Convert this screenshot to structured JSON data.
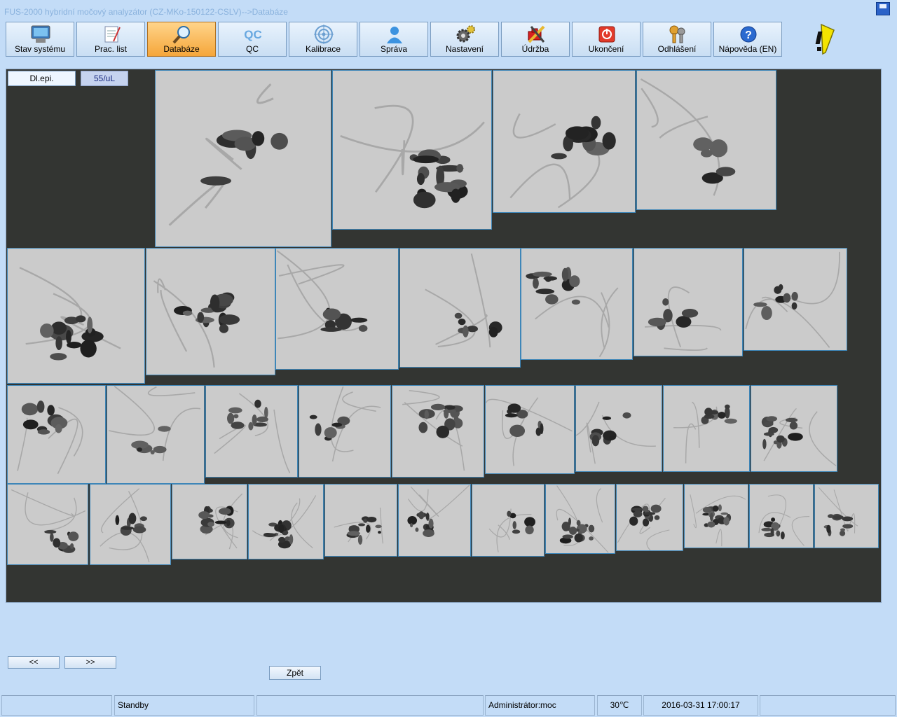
{
  "window": {
    "title": "FUS-2000 hybridní močový analyzátor (CZ-MKo-150122-CSLV)-->Databáze"
  },
  "toolbar": {
    "buttons": [
      {
        "label": "Stav systému",
        "icon": "monitor-icon"
      },
      {
        "label": "Prac. list",
        "icon": "notepad-icon"
      },
      {
        "label": "Databáze",
        "icon": "magnifier-icon",
        "active": true
      },
      {
        "label": "QC",
        "icon": "qc-text-icon"
      },
      {
        "label": "Kalibrace",
        "icon": "target-icon"
      },
      {
        "label": "Správa",
        "icon": "user-icon"
      },
      {
        "label": "Nastavení",
        "icon": "gear-icon"
      },
      {
        "label": "Údržba",
        "icon": "tools-icon"
      },
      {
        "label": "Ukončení",
        "icon": "power-icon"
      },
      {
        "label": "Odhlášení",
        "icon": "keys-icon"
      },
      {
        "label": "Nápověda (EN)",
        "icon": "help-icon"
      }
    ],
    "qc_icon_text": "QC"
  },
  "viewer": {
    "class_label": "Dl.epi.",
    "concentration": "55/uL",
    "tile_count": 40
  },
  "navigation": {
    "prev_label": "<<",
    "next_label": ">>",
    "back_label": "Zpět"
  },
  "statusbar": {
    "field1": "",
    "state": "Standby",
    "field3": "",
    "user": "Administrátor:moc",
    "temperature": "30℃",
    "datetime": "2016-03-31 17:00:17"
  },
  "colors": {
    "background": "#c3dcf7",
    "viewer_bg": "#333532",
    "active_button": "#f5a63a",
    "tile_border": "#3e86b8",
    "warning": "#f4e400"
  }
}
